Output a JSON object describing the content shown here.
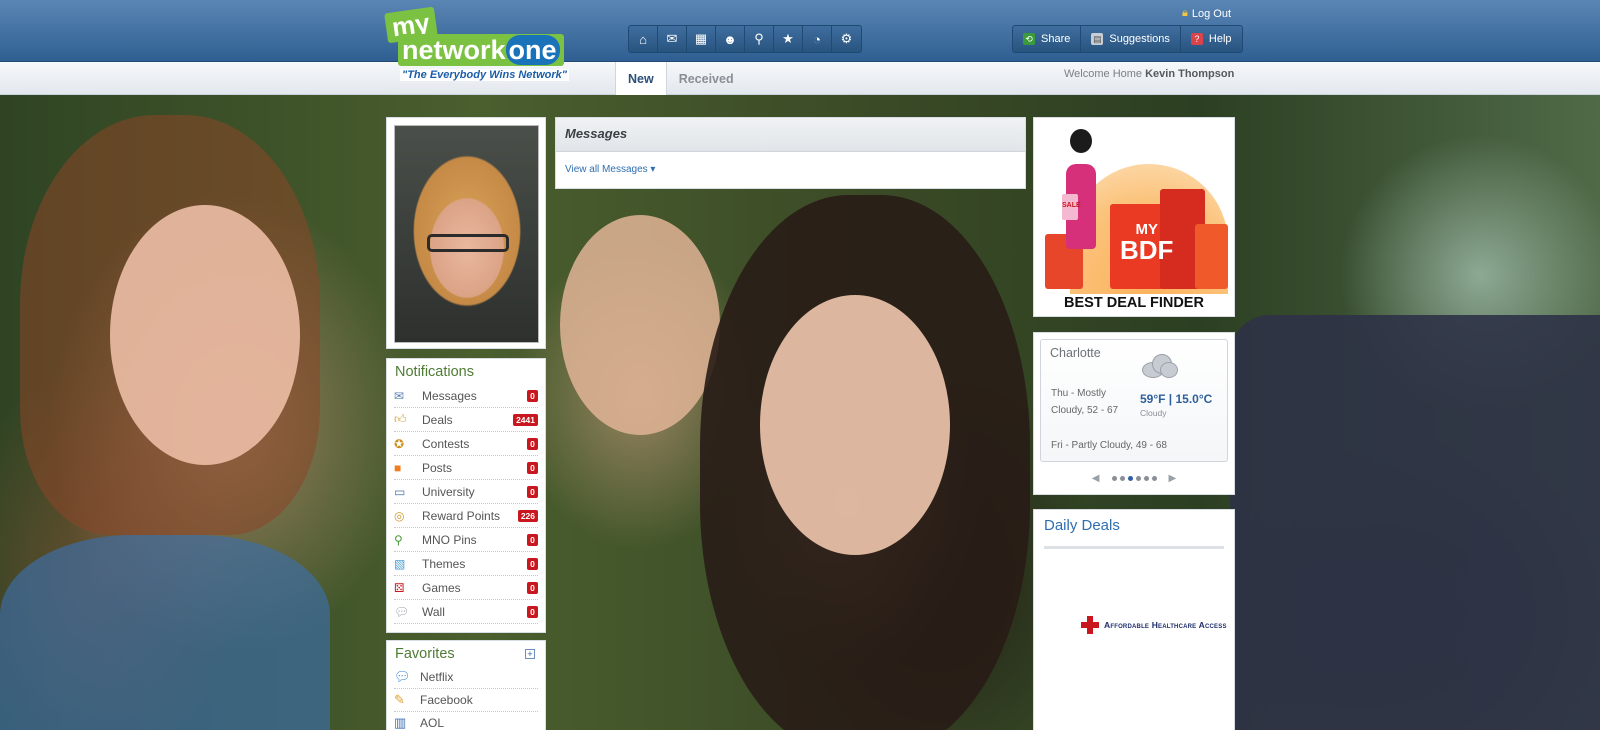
{
  "brand": {
    "logo_my": "my",
    "logo_network": "network",
    "logo_one": "one",
    "tagline": "\"The Everybody Wins Network\""
  },
  "toolbar": {
    "icons": [
      "home-icon",
      "mail-icon",
      "calendar-icon",
      "users-icon",
      "search-icon",
      "star-icon",
      "rss-icon",
      "gear-icon"
    ]
  },
  "header": {
    "logout_label": "Log Out",
    "buttons": [
      {
        "label": "Share",
        "icon": "share-icon"
      },
      {
        "label": "Suggestions",
        "icon": "suggestions-icon"
      },
      {
        "label": "Help",
        "icon": "help-icon"
      }
    ]
  },
  "tabs": [
    {
      "label": "New",
      "active": true
    },
    {
      "label": "Received",
      "active": false
    }
  ],
  "welcome": {
    "prefix": "Welcome Home",
    "user_name": "Kevin Thompson"
  },
  "notifications": {
    "title": "Notifications",
    "items": [
      {
        "label": "Messages",
        "count": "0",
        "icon": "envelope-icon"
      },
      {
        "label": "Deals",
        "count": "2441",
        "icon": "thumbs-up-icon"
      },
      {
        "label": "Contests",
        "count": "0",
        "icon": "ribbon-icon"
      },
      {
        "label": "Posts",
        "count": "0",
        "icon": "blogger-icon"
      },
      {
        "label": "University",
        "count": "0",
        "icon": "book-icon"
      },
      {
        "label": "Reward Points",
        "count": "226",
        "icon": "coins-icon"
      },
      {
        "label": "MNO Pins",
        "count": "0",
        "icon": "pin-icon"
      },
      {
        "label": "Themes",
        "count": "0",
        "icon": "palette-icon"
      },
      {
        "label": "Games",
        "count": "0",
        "icon": "dice-icon"
      },
      {
        "label": "Wall",
        "count": "0",
        "icon": "speech-bubble-icon"
      }
    ]
  },
  "favorites": {
    "title": "Favorites",
    "add_label": "+",
    "items": [
      {
        "label": "Netflix",
        "icon": "chat-bubbles-icon"
      },
      {
        "label": "Facebook",
        "icon": "pencil-icon"
      },
      {
        "label": "AOL",
        "icon": "notebook-icon"
      }
    ]
  },
  "messages": {
    "title": "Messages",
    "view_all": "View all Messages ▾"
  },
  "bdf_ad": {
    "logo_line1": "MY",
    "logo_line2": "BDF",
    "sale_tag": "SALE",
    "label": "BEST DEAL FINDER"
  },
  "weather": {
    "city": "Charlotte",
    "forecast_thu": "Thu - Mostly Cloudy, 52 - 67",
    "forecast_fri": "Fri - Partly Cloudy, 49 - 68",
    "temperature": "59°F | 15.0°C",
    "condition": "Cloudy",
    "pager_prev": "◀",
    "pager_next": "▶",
    "pager_pages": 6,
    "pager_active": 2
  },
  "daily_deals": {
    "title": "Daily Deals",
    "advertiser": "Affordable Healthcare Access"
  },
  "colors": {
    "header_blue": "#2f5f92",
    "brand_green": "#7cc242",
    "link_blue": "#2f6eb0",
    "badge_red": "#c8171e",
    "panel_title_green": "#4f7c35"
  }
}
